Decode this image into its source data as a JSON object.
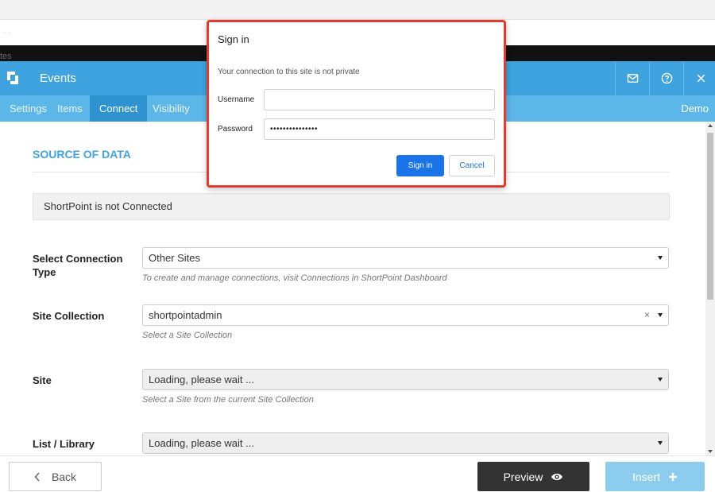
{
  "browser": {
    "partial_text": "tes"
  },
  "header": {
    "title": "Events",
    "icons": [
      "mail-icon",
      "help-circle-icon",
      "close-icon"
    ]
  },
  "tabs": [
    {
      "label": "Settings",
      "active": false
    },
    {
      "label": "Items",
      "active": false
    },
    {
      "label": "Connect",
      "active": true
    },
    {
      "label": "Visibility",
      "active": false
    }
  ],
  "demo_label": "Demo",
  "main": {
    "section_title": "SOURCE OF DATA",
    "status": "ShortPoint is not Connected",
    "fields": {
      "connection_type": {
        "label": "Select Connection Type",
        "value": "Other Sites",
        "help": "To create and manage connections, visit Connections in ShortPoint Dashboard"
      },
      "site_collection": {
        "label": "Site Collection",
        "value": "shortpointadmin",
        "clear": "×",
        "help": "Select a Site Collection"
      },
      "site": {
        "label": "Site",
        "value": "Loading, please wait ...",
        "help": "Select a Site from the current Site Collection"
      },
      "list_library": {
        "label": "List / Library",
        "value": "Loading, please wait ..."
      }
    }
  },
  "footer": {
    "back_label": "Back",
    "preview_label": "Preview",
    "insert_label": "Insert"
  },
  "dialog": {
    "title": "Sign in",
    "message": "Your connection to this site is not private",
    "username_label": "Username",
    "username_value": "",
    "password_label": "Password",
    "password_value": "•••••••••••••••",
    "signin_label": "Sign in",
    "cancel_label": "Cancel"
  },
  "colors": {
    "brand_blue": "#3ea3de",
    "tab_bar": "#5db6e8",
    "tab_active": "#2f93cf",
    "dialog_highlight": "#e03c31",
    "signin_blue": "#1a73e8",
    "preview_dark": "#333333",
    "insert_light_blue": "#8ccdee"
  }
}
